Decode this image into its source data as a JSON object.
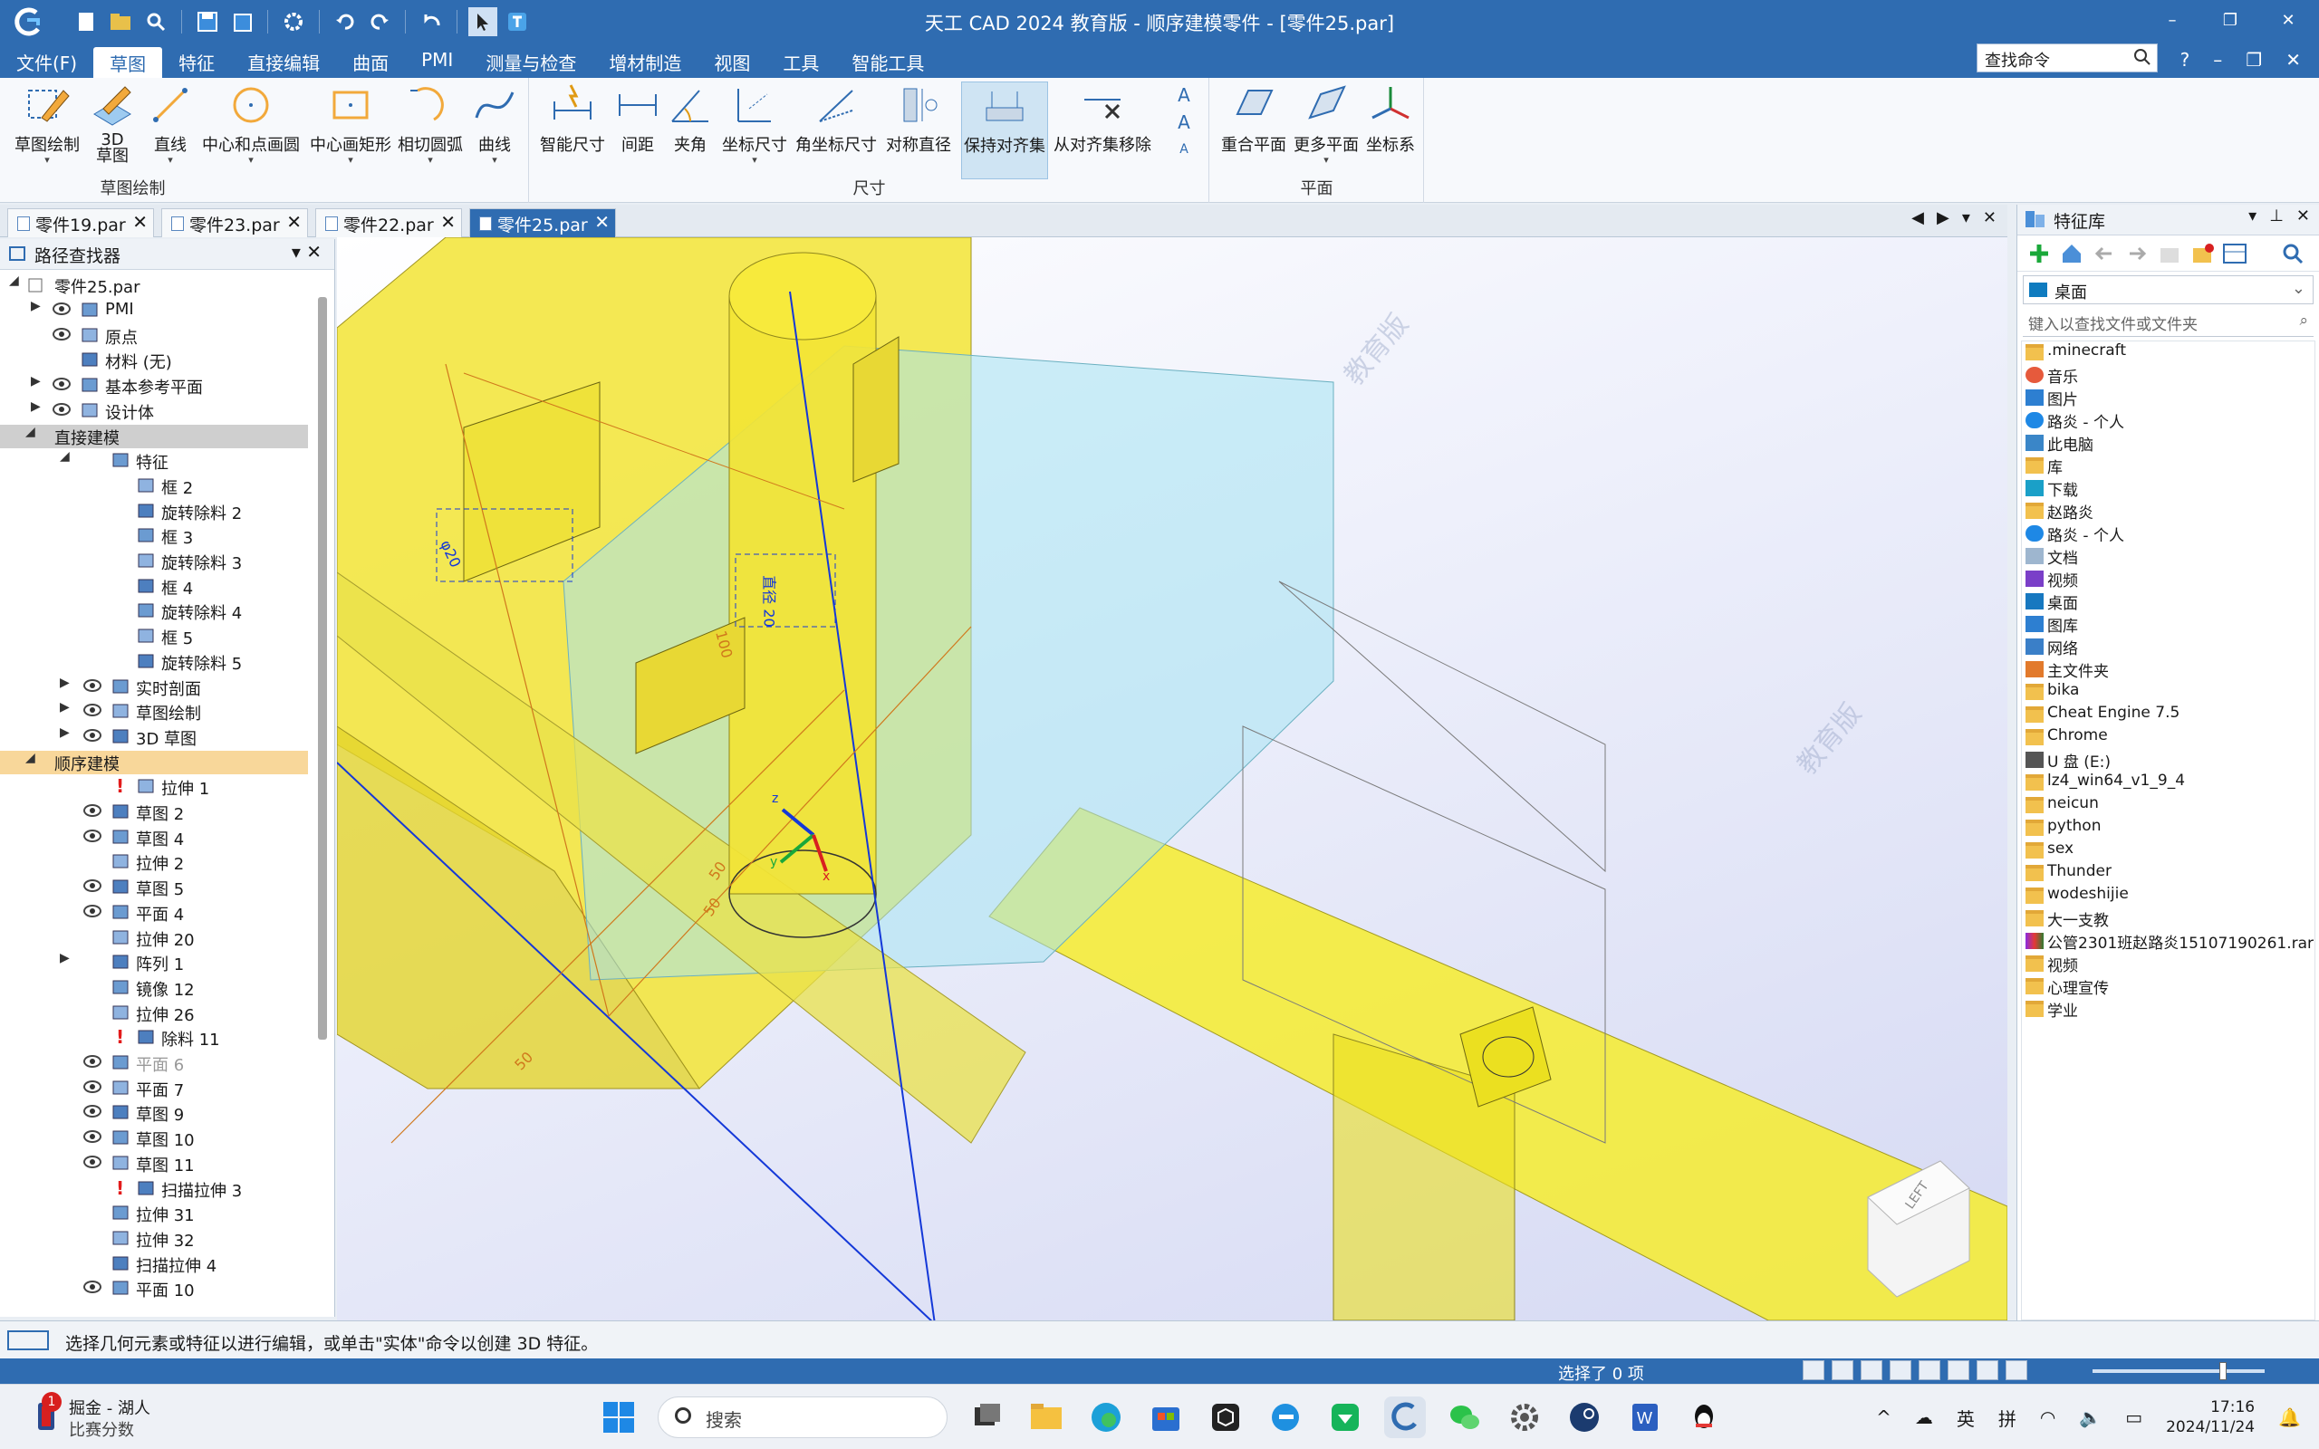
{
  "window": {
    "title": "天工 CAD 2024 教育版 - 顺序建模零件 - [零件25.par]",
    "controls": [
      "–",
      "❐",
      "✕"
    ]
  },
  "menu": {
    "tabs": [
      "文件(F)",
      "草图",
      "特征",
      "直接编辑",
      "曲面",
      "PMI",
      "测量与检查",
      "增材制造",
      "视图",
      "工具",
      "智能工具"
    ],
    "active_index": 1,
    "search_placeholder": "查找命令",
    "right": [
      "?",
      "–",
      "❐",
      "✕"
    ]
  },
  "ribbon": {
    "groups": [
      {
        "label": "草图绘制",
        "buttons": [
          "草图绘制",
          "3D\n草图",
          "直线",
          "中心和点画圆",
          "中心画矩形",
          "相切圆弧",
          "曲线"
        ]
      },
      {
        "label": "尺寸",
        "buttons": [
          "智能尺寸",
          "间距",
          "夹角",
          "坐标尺寸",
          "角坐标尺寸",
          "对称直径",
          "保持对齐集",
          "从对齐集移除"
        ]
      },
      {
        "label": "平面",
        "buttons": [
          "重合平面",
          "更多平面",
          "坐标系"
        ]
      }
    ],
    "selected_button": "保持对齐集",
    "text_tool_glyphs": [
      "A",
      "A",
      "A"
    ]
  },
  "doc_tabs": {
    "tabs": [
      "零件19.par",
      "零件23.par",
      "零件22.par",
      "零件25.par"
    ],
    "active_index": 3,
    "nav": [
      "◀",
      "▶",
      "▾",
      "✕"
    ]
  },
  "pathfinder": {
    "title": "路径查找器",
    "root": "零件25.par",
    "rows": [
      {
        "label": "PMI",
        "level": 1,
        "exp": "▶",
        "eye": true
      },
      {
        "label": "原点",
        "level": 1,
        "exp": "",
        "eye": true
      },
      {
        "label": "材料 (无)",
        "level": 1,
        "exp": "",
        "eye": false
      },
      {
        "label": "基本参考平面",
        "level": 1,
        "exp": "▶",
        "eye": true
      },
      {
        "label": "设计体",
        "level": 1,
        "exp": "▶",
        "eye": true
      },
      {
        "label": "直接建模",
        "level": 0,
        "exp": "◢",
        "eye": false,
        "hl": "gray"
      },
      {
        "label": "特征",
        "level": 2,
        "exp": "◢",
        "eye": false
      },
      {
        "label": "框 2",
        "level": 3,
        "exp": "",
        "eye": false
      },
      {
        "label": "旋转除料 2",
        "level": 3,
        "exp": "",
        "eye": false
      },
      {
        "label": "框 3",
        "level": 3,
        "exp": "",
        "eye": false
      },
      {
        "label": "旋转除料 3",
        "level": 3,
        "exp": "",
        "eye": false
      },
      {
        "label": "框 4",
        "level": 3,
        "exp": "",
        "eye": false
      },
      {
        "label": "旋转除料 4",
        "level": 3,
        "exp": "",
        "eye": false
      },
      {
        "label": "框 5",
        "level": 3,
        "exp": "",
        "eye": false
      },
      {
        "label": "旋转除料 5",
        "level": 3,
        "exp": "",
        "eye": false
      },
      {
        "label": "实时剖面",
        "level": 2,
        "exp": "▶",
        "eye": true
      },
      {
        "label": "草图绘制",
        "level": 2,
        "exp": "▶",
        "eye": true
      },
      {
        "label": "3D 草图",
        "level": 2,
        "exp": "▶",
        "eye": true
      },
      {
        "label": "顺序建模",
        "level": 0,
        "exp": "◢",
        "eye": false,
        "hl": "orange"
      },
      {
        "label": "拉伸 1",
        "level": 3,
        "exp": "",
        "eye": false,
        "err": true
      },
      {
        "label": "草图 2",
        "level": 2,
        "exp": "",
        "eye": true
      },
      {
        "label": "草图 4",
        "level": 2,
        "exp": "",
        "eye": true
      },
      {
        "label": "拉伸 2",
        "level": 2,
        "exp": "",
        "eye": false
      },
      {
        "label": "草图 5",
        "level": 2,
        "exp": "",
        "eye": true
      },
      {
        "label": "平面 4",
        "level": 2,
        "exp": "",
        "eye": true
      },
      {
        "label": "拉伸 20",
        "level": 2,
        "exp": "",
        "eye": false
      },
      {
        "label": "阵列 1",
        "level": 2,
        "exp": "▶",
        "eye": false
      },
      {
        "label": "镜像 12",
        "level": 2,
        "exp": "",
        "eye": false
      },
      {
        "label": "拉伸 26",
        "level": 2,
        "exp": "",
        "eye": false
      },
      {
        "label": "除料 11",
        "level": 3,
        "exp": "",
        "eye": false,
        "err": true
      },
      {
        "label": "平面 6",
        "level": 2,
        "exp": "",
        "eye": true,
        "dim": true
      },
      {
        "label": "平面 7",
        "level": 2,
        "exp": "",
        "eye": true
      },
      {
        "label": "草图 9",
        "level": 2,
        "exp": "",
        "eye": true
      },
      {
        "label": "草图 10",
        "level": 2,
        "exp": "",
        "eye": true
      },
      {
        "label": "草图 11",
        "level": 2,
        "exp": "",
        "eye": true
      },
      {
        "label": "扫描拉伸 3",
        "level": 3,
        "exp": "",
        "eye": false,
        "err": true
      },
      {
        "label": "拉伸 31",
        "level": 2,
        "exp": "",
        "eye": false
      },
      {
        "label": "拉伸 32",
        "level": 2,
        "exp": "",
        "eye": false
      },
      {
        "label": "扫描拉伸 4",
        "level": 2,
        "exp": "",
        "eye": false
      },
      {
        "label": "平面 10",
        "level": 2,
        "exp": "",
        "eye": true
      }
    ]
  },
  "viewport": {
    "watermark": "教育版",
    "dimension_labels": [
      "50",
      "50",
      "50",
      "φ20",
      "直径 20",
      "100"
    ],
    "axis_labels": {
      "x": "x",
      "y": "y",
      "z": "z"
    },
    "cube_face": "LEFT",
    "colors": {
      "body": "#f0e22a",
      "glass": "#9fe2f0",
      "sketch": "#1438d8",
      "dimension": "#d0781c"
    }
  },
  "feature_library": {
    "title": "特征库",
    "location": "桌面",
    "filter_placeholder": "键入以查找文件或文件夹",
    "items": [
      {
        "name": ".minecraft",
        "icon": "folder"
      },
      {
        "name": "音乐",
        "icon": "music"
      },
      {
        "name": "图片",
        "icon": "pictures"
      },
      {
        "name": "路炎 - 个人",
        "icon": "cloud"
      },
      {
        "name": "此电脑",
        "icon": "pc"
      },
      {
        "name": "库",
        "icon": "folder"
      },
      {
        "name": "下载",
        "icon": "download"
      },
      {
        "name": "赵路炎",
        "icon": "folder"
      },
      {
        "name": "路炎 - 个人",
        "icon": "cloud"
      },
      {
        "name": "文档",
        "icon": "doc"
      },
      {
        "name": "视频",
        "icon": "video"
      },
      {
        "name": "桌面",
        "icon": "desktop"
      },
      {
        "name": "图库",
        "icon": "pictures"
      },
      {
        "name": "网络",
        "icon": "network"
      },
      {
        "name": "主文件夹",
        "icon": "home"
      },
      {
        "name": "bika",
        "icon": "folder"
      },
      {
        "name": "Cheat Engine 7.5",
        "icon": "folder"
      },
      {
        "name": "Chrome",
        "icon": "folder"
      },
      {
        "name": "U 盘 (E:)",
        "icon": "drive"
      },
      {
        "name": "lz4_win64_v1_9_4",
        "icon": "folder"
      },
      {
        "name": "neicun",
        "icon": "folder"
      },
      {
        "name": "python",
        "icon": "folder"
      },
      {
        "name": "sex",
        "icon": "folder"
      },
      {
        "name": "Thunder",
        "icon": "folder"
      },
      {
        "name": "wodeshijie",
        "icon": "folder"
      },
      {
        "name": "大一支教",
        "icon": "folder"
      },
      {
        "name": "公管2301班赵路炎15107190261.rar",
        "icon": "rar"
      },
      {
        "name": "视频",
        "icon": "folder"
      },
      {
        "name": "心理宣传",
        "icon": "folder"
      },
      {
        "name": "学业",
        "icon": "folder"
      }
    ]
  },
  "status": {
    "message": "选择几何元素或特征以进行编辑，或单击\"实体\"命令以创建 3D 特征。",
    "selection": "选择了 0 项"
  },
  "taskbar": {
    "weather_line1": "掘金 - 湖人",
    "weather_line2": "比赛分数",
    "badge": "1",
    "search": "搜索",
    "ime1": "英",
    "ime2": "拼",
    "time": "17:16",
    "date": "2024/11/24"
  }
}
